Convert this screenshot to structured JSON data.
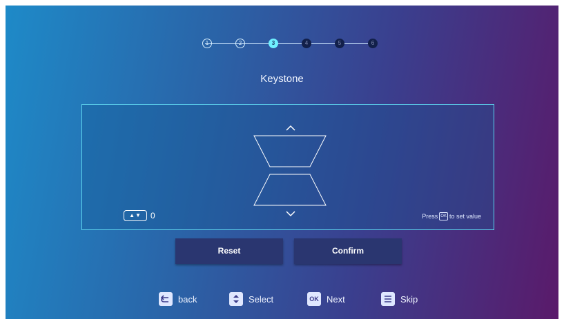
{
  "stepper": {
    "steps": [
      {
        "label": "1",
        "state": "done"
      },
      {
        "label": "2",
        "state": "done"
      },
      {
        "label": "3",
        "state": "current"
      },
      {
        "label": "4",
        "state": "todo"
      },
      {
        "label": "5",
        "state": "todo"
      },
      {
        "label": "6",
        "state": "todo"
      }
    ]
  },
  "title": "Keystone",
  "keystone": {
    "value": "0",
    "up_arrow": "^",
    "down_arrow": "v",
    "hint_prefix": "Press",
    "hint_key": "OK",
    "hint_suffix": "to set value"
  },
  "buttons": {
    "reset": "Reset",
    "confirm": "Confirm"
  },
  "footer": {
    "back": "back",
    "select": "Select",
    "next": "Next",
    "skip": "Skip",
    "ok_key": "OK"
  },
  "colors": {
    "accent": "#6ff0ff",
    "panel_border": "#5fd6f0",
    "button_bg": "#2a3670"
  }
}
